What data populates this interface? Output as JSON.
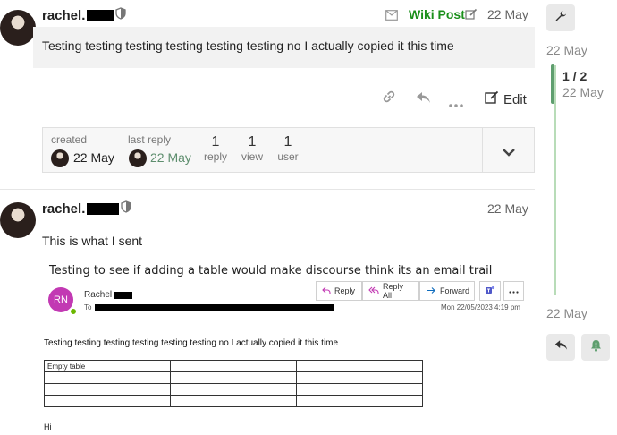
{
  "post1": {
    "username": "rachel.",
    "wiki_label": "Wiki Post",
    "date": "22 May",
    "body": "Testing testing testing testing testing testing no I actually copied it this time",
    "edit_label": "Edit"
  },
  "topic_map": {
    "created_label": "created",
    "created_date": "22 May",
    "last_reply_label": "last reply",
    "last_reply_date": "22 May",
    "replies_count": "1",
    "replies_label": "reply",
    "views_count": "1",
    "views_label": "view",
    "users_count": "1",
    "users_label": "user"
  },
  "post2": {
    "username": "rachel.",
    "date": "22 May",
    "body": "This is what I sent"
  },
  "email": {
    "subject": "Testing to see if adding a table would make discourse think its an email trail",
    "avatar_initials": "RN",
    "sender_name": "Rachel",
    "to_label": "To",
    "reply_label": "Reply",
    "reply_all_label": "Reply All",
    "forward_label": "Forward",
    "timestamp": "Mon 22/05/2023 4:19 pm",
    "body_line": "Testing testing testing testing testing testing no I actually copied it this time",
    "table_rows": [
      [
        "Empty table",
        "",
        ""
      ],
      [
        "",
        "",
        ""
      ],
      [
        "",
        "",
        ""
      ],
      [
        "",
        "",
        ""
      ]
    ],
    "closing": "Hi"
  },
  "timeline": {
    "top_date": "22 May",
    "position": "1 / 2",
    "position_date": "22 May",
    "bottom_date": "22 May"
  },
  "colors": {
    "wiki_green": "#1a8f1a",
    "last_reply_green": "#5e8e6e",
    "timeline_green": "#5e9e6e",
    "outlook_blue": "#0f6cbd",
    "avatar_magenta": "#c239b3"
  }
}
